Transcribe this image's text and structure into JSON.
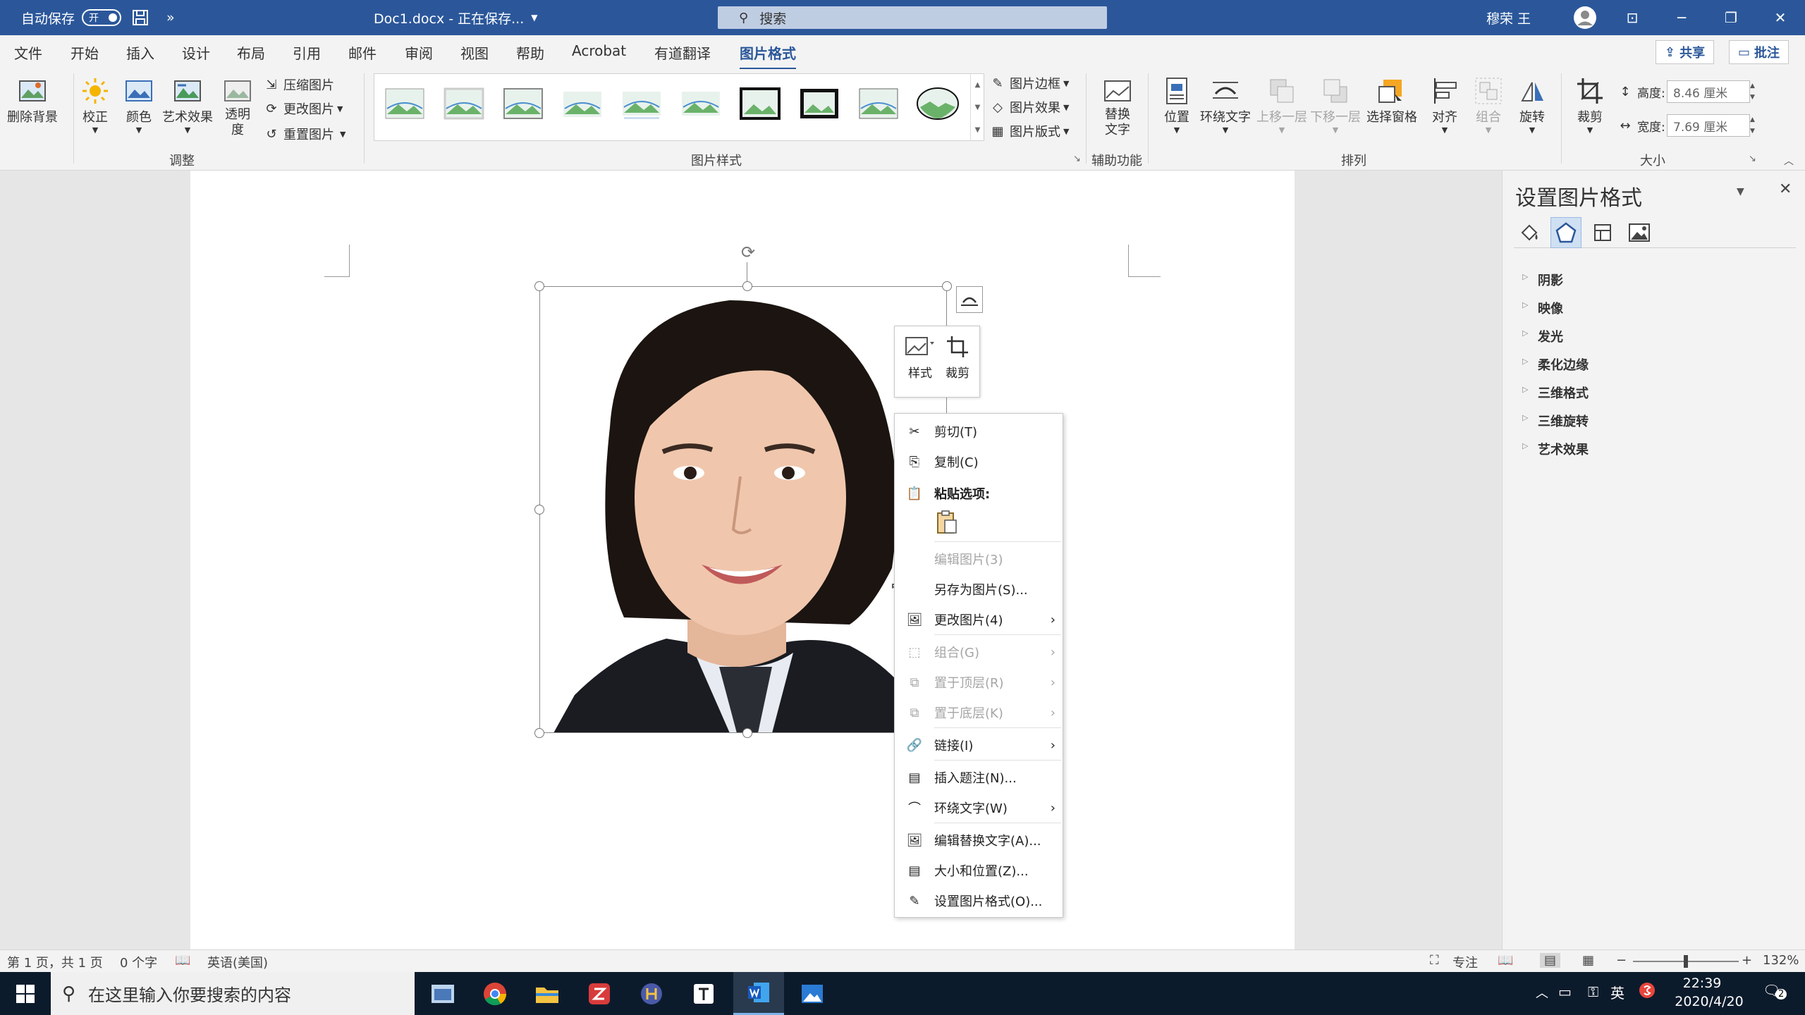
{
  "titlebar": {
    "autosave_label": "自动保存",
    "autosave_toggle": "开",
    "doc_title": "Doc1.docx - 正在保存...",
    "search_placeholder": "搜索",
    "user_name": "穆荣 王",
    "more": "»"
  },
  "menu": {
    "tabs": [
      "文件",
      "开始",
      "插入",
      "设计",
      "布局",
      "引用",
      "邮件",
      "审阅",
      "视图",
      "帮助",
      "Acrobat",
      "有道翻译",
      "图片格式"
    ],
    "share": "共享",
    "comment": "批注"
  },
  "ribbon": {
    "remove_bg": "删除背景",
    "correct": "校正",
    "color": "颜色",
    "art_effect": "艺术效果",
    "transparency": "透明度",
    "compress": "压缩图片",
    "change": "更改图片",
    "reset": "重置图片",
    "group_adjust": "调整",
    "group_styles": "图片样式",
    "border": "图片边框",
    "effect": "图片效果",
    "layout": "图片版式",
    "alt_text": "替换文字",
    "group_access": "辅助功能",
    "position": "位置",
    "wrap": "环绕文字",
    "forward": "上移一层",
    "backward": "下移一层",
    "select_pane": "选择窗格",
    "align": "对齐",
    "group_obj": "组合",
    "rotate": "旋转",
    "group_arrange": "排列",
    "crop": "裁剪",
    "height_label": "高度:",
    "height_value": "8.46 厘米",
    "width_label": "宽度:",
    "width_value": "7.69 厘米",
    "group_size": "大小"
  },
  "mini_toolbar": {
    "style": "样式",
    "crop": "裁剪"
  },
  "context_menu": {
    "items": [
      {
        "label": "剪切(T)",
        "enabled": true
      },
      {
        "label": "复制(C)",
        "enabled": true
      },
      {
        "label": "粘贴选项:",
        "enabled": true
      },
      {
        "label": "编辑图片(3)",
        "enabled": false
      },
      {
        "label": "另存为图片(S)...",
        "enabled": true
      },
      {
        "label": "更改图片(4)",
        "enabled": true
      },
      {
        "label": "组合(G)",
        "enabled": false
      },
      {
        "label": "置于顶层(R)",
        "enabled": false
      },
      {
        "label": "置于底层(K)",
        "enabled": false
      },
      {
        "label": "链接(I)",
        "enabled": true
      },
      {
        "label": "插入题注(N)...",
        "enabled": true
      },
      {
        "label": "环绕文字(W)",
        "enabled": true
      },
      {
        "label": "编辑替换文字(A)...",
        "enabled": true
      },
      {
        "label": "大小和位置(Z)...",
        "enabled": true
      },
      {
        "label": "设置图片格式(O)...",
        "enabled": true
      }
    ]
  },
  "pane": {
    "title": "设置图片格式",
    "sections": [
      "阴影",
      "映像",
      "发光",
      "柔化边缘",
      "三维格式",
      "三维旋转",
      "艺术效果"
    ]
  },
  "status": {
    "page": "第 1 页，共 1 页",
    "words": "0 个字",
    "lang": "英语(美国)",
    "focus": "专注",
    "zoom": "132%"
  },
  "taskbar": {
    "search": "在这里输入你要搜索的内容",
    "ime": "英",
    "time": "22:39",
    "date": "2020/4/20",
    "notif_count": "2"
  },
  "colors": {
    "accent": "#2b579a",
    "taskbar": "#0c1b2c"
  }
}
